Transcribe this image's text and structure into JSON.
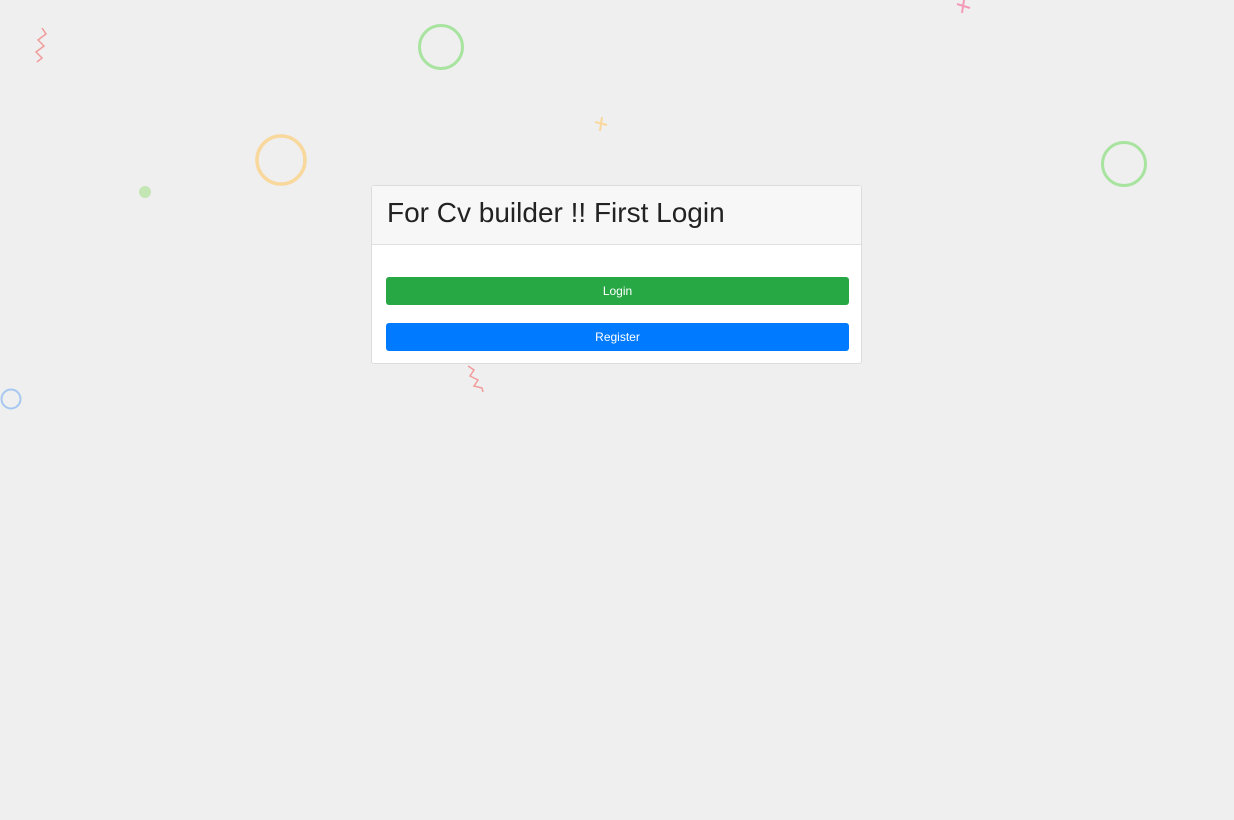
{
  "page": {
    "heading": "For Cv builder !! First Login"
  },
  "actions": {
    "login_label": "Login",
    "register_label": "Register"
  },
  "colors": {
    "background": "#efefef",
    "login_button": "#28a745",
    "register_button": "#007bff"
  },
  "decorations": {
    "icons": [
      "zigzag-icon",
      "ring-icon",
      "plus-icon",
      "dot-icon"
    ],
    "colors": [
      "#f19c9c",
      "#a8e4a0",
      "#f8d89c",
      "#f49ab8",
      "#a6c8f0",
      "#c4e6b4"
    ]
  }
}
